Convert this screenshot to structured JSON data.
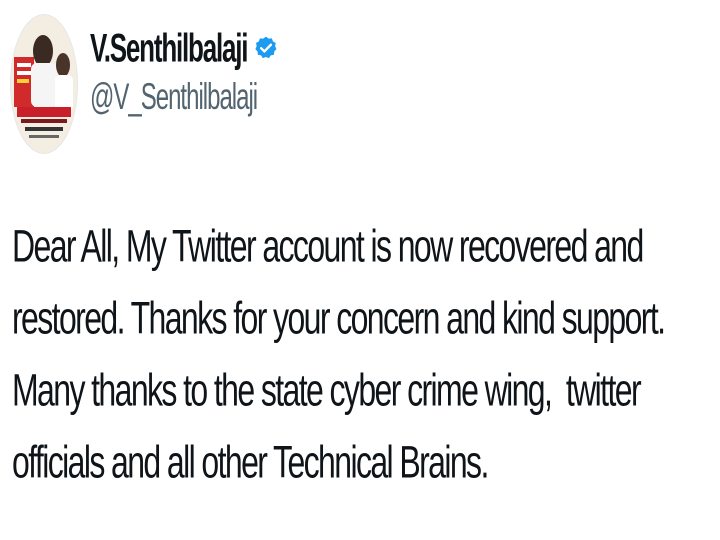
{
  "profile": {
    "display_name": "V.Senthilbalaji",
    "handle": "@V_Senthilbalaji",
    "verified_color": "#1d9bf0",
    "avatar_icon": "profile-photo",
    "verified_icon": "verified-badge-icon"
  },
  "tweet": {
    "lines": [
      "Dear All, My Twitter account is now recovered and",
      "restored. Thanks for your concern and kind support.",
      "Many thanks to the state cyber crime wing,  twitter",
      "officials and all other Technical Brains."
    ]
  }
}
